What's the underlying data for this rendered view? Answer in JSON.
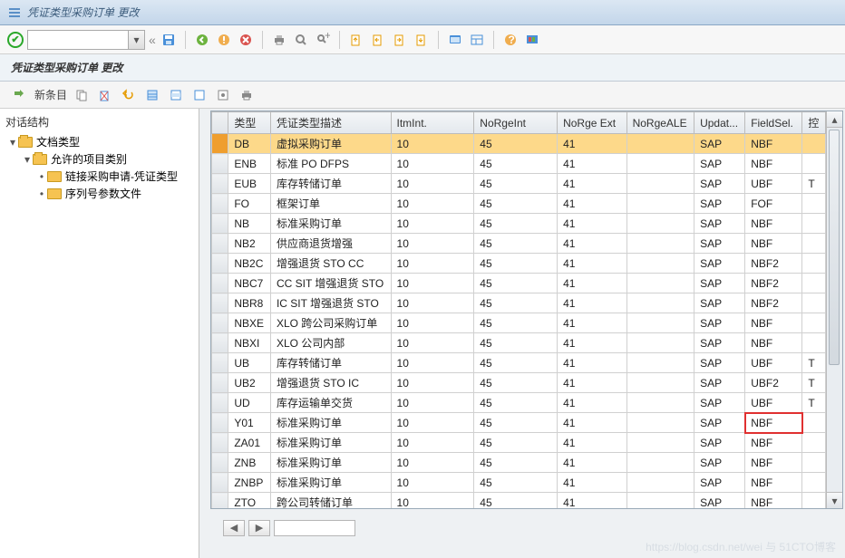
{
  "window": {
    "title": "凭证类型采购订单 更改"
  },
  "subheader": {
    "title": "凭证类型采购订单 更改"
  },
  "apptoolbar": {
    "new_entry": "新条目"
  },
  "sidebar": {
    "header": "对话结构",
    "nodes": {
      "doc_type": "文档类型",
      "allowed_item": "允许的项目类别",
      "link_pr": "链接采购申请-凭证类型",
      "seq_file": "序列号参数文件"
    }
  },
  "table": {
    "columns": {
      "type": "类型",
      "desc": "凭证类型描述",
      "itmint": "ItmInt.",
      "norgeint": "NoRgeInt",
      "norgeext": "NoRge Ext",
      "norgeale": "NoRgeALE",
      "updat": "Updat...",
      "fieldsel": "FieldSel.",
      "ctrl": "控"
    },
    "rows": [
      {
        "type": "DB",
        "desc": "虚拟采购订单",
        "itmint": "10",
        "norgeint": "45",
        "norgeext": "41",
        "norgeale": "",
        "updat": "SAP",
        "fieldsel": "NBF",
        "ctrl": "",
        "sel": true
      },
      {
        "type": "ENB",
        "desc": "标准 PO DFPS",
        "itmint": "10",
        "norgeint": "45",
        "norgeext": "41",
        "norgeale": "",
        "updat": "SAP",
        "fieldsel": "NBF",
        "ctrl": ""
      },
      {
        "type": "EUB",
        "desc": "库存转储订单",
        "itmint": "10",
        "norgeint": "45",
        "norgeext": "41",
        "norgeale": "",
        "updat": "SAP",
        "fieldsel": "UBF",
        "ctrl": "T"
      },
      {
        "type": "FO",
        "desc": "框架订单",
        "itmint": "10",
        "norgeint": "45",
        "norgeext": "41",
        "norgeale": "",
        "updat": "SAP",
        "fieldsel": "FOF",
        "ctrl": ""
      },
      {
        "type": "NB",
        "desc": "标准采购订单",
        "itmint": "10",
        "norgeint": "45",
        "norgeext": "41",
        "norgeale": "",
        "updat": "SAP",
        "fieldsel": "NBF",
        "ctrl": ""
      },
      {
        "type": "NB2",
        "desc": "供应商退货增强",
        "itmint": "10",
        "norgeint": "45",
        "norgeext": "41",
        "norgeale": "",
        "updat": "SAP",
        "fieldsel": "NBF",
        "ctrl": ""
      },
      {
        "type": "NB2C",
        "desc": "增强退货 STO CC",
        "itmint": "10",
        "norgeint": "45",
        "norgeext": "41",
        "norgeale": "",
        "updat": "SAP",
        "fieldsel": "NBF2",
        "ctrl": ""
      },
      {
        "type": "NBC7",
        "desc": "CC SIT 增强退货 STO",
        "itmint": "10",
        "norgeint": "45",
        "norgeext": "41",
        "norgeale": "",
        "updat": "SAP",
        "fieldsel": "NBF2",
        "ctrl": ""
      },
      {
        "type": "NBR8",
        "desc": "IC SIT 增强退货 STO",
        "itmint": "10",
        "norgeint": "45",
        "norgeext": "41",
        "norgeale": "",
        "updat": "SAP",
        "fieldsel": "NBF2",
        "ctrl": ""
      },
      {
        "type": "NBXE",
        "desc": "XLO 跨公司采购订单",
        "itmint": "10",
        "norgeint": "45",
        "norgeext": "41",
        "norgeale": "",
        "updat": "SAP",
        "fieldsel": "NBF",
        "ctrl": ""
      },
      {
        "type": "NBXI",
        "desc": "XLO 公司内部",
        "itmint": "10",
        "norgeint": "45",
        "norgeext": "41",
        "norgeale": "",
        "updat": "SAP",
        "fieldsel": "NBF",
        "ctrl": ""
      },
      {
        "type": "UB",
        "desc": "库存转储订单",
        "itmint": "10",
        "norgeint": "45",
        "norgeext": "41",
        "norgeale": "",
        "updat": "SAP",
        "fieldsel": "UBF",
        "ctrl": "T"
      },
      {
        "type": "UB2",
        "desc": "增强退货 STO IC",
        "itmint": "10",
        "norgeint": "45",
        "norgeext": "41",
        "norgeale": "",
        "updat": "SAP",
        "fieldsel": "UBF2",
        "ctrl": "T"
      },
      {
        "type": "UD",
        "desc": "库存运输单交货",
        "itmint": "10",
        "norgeint": "45",
        "norgeext": "41",
        "norgeale": "",
        "updat": "SAP",
        "fieldsel": "UBF",
        "ctrl": "T"
      },
      {
        "type": "Y01",
        "desc": "标准采购订单",
        "itmint": "10",
        "norgeint": "45",
        "norgeext": "41",
        "norgeale": "",
        "updat": "SAP",
        "fieldsel": "NBF",
        "ctrl": "",
        "hl": true
      },
      {
        "type": "ZA01",
        "desc": "标准采购订单",
        "itmint": "10",
        "norgeint": "45",
        "norgeext": "41",
        "norgeale": "",
        "updat": "SAP",
        "fieldsel": "NBF",
        "ctrl": ""
      },
      {
        "type": "ZNB",
        "desc": "标准采购订单",
        "itmint": "10",
        "norgeint": "45",
        "norgeext": "41",
        "norgeale": "",
        "updat": "SAP",
        "fieldsel": "NBF",
        "ctrl": ""
      },
      {
        "type": "ZNBP",
        "desc": "标准采购订单",
        "itmint": "10",
        "norgeint": "45",
        "norgeext": "41",
        "norgeale": "",
        "updat": "SAP",
        "fieldsel": "NBF",
        "ctrl": ""
      },
      {
        "type": "ZTO",
        "desc": "跨公司转储订单",
        "itmint": "10",
        "norgeint": "45",
        "norgeext": "41",
        "norgeale": "",
        "updat": "SAP",
        "fieldsel": "NBF",
        "ctrl": ""
      }
    ]
  },
  "watermark": "https://blog.csdn.net/wei 与 51CTO博客"
}
